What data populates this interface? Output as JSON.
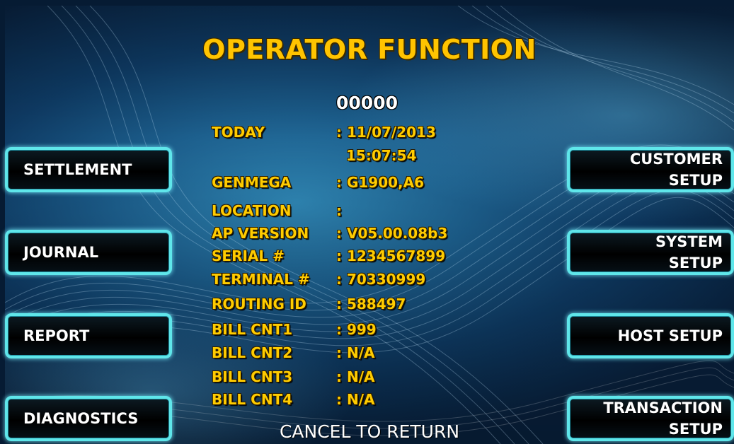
{
  "screen": {
    "title": "OPERATOR FUNCTION",
    "code": "00000",
    "footer": "CANCEL TO RETURN"
  },
  "info": [
    {
      "label": "TODAY",
      "value": ": 11/07/2013"
    },
    {
      "label": "",
      "value": "15:07:54"
    },
    {
      "label": "GENMEGA",
      "value": ": G1900,A6"
    },
    {
      "label": "LOCATION",
      "value": ":"
    },
    {
      "label": "AP VERSION",
      "value": ": V05.00.08b3"
    },
    {
      "label": "SERIAL #",
      "value": ": 1234567899"
    },
    {
      "label": "TERMINAL #",
      "value": ": 70330999"
    },
    {
      "label": "ROUTING ID",
      "value": ": 588497"
    },
    {
      "label": "BILL CNT1",
      "value": ": 999"
    },
    {
      "label": "BILL CNT2",
      "value": ": N/A"
    },
    {
      "label": "BILL CNT3",
      "value": ": N/A"
    },
    {
      "label": "BILL CNT4",
      "value": ": N/A"
    }
  ],
  "left_buttons": [
    "SETTLEMENT",
    "JOURNAL",
    "REPORT",
    "DIAGNOSTICS"
  ],
  "right_buttons": [
    {
      "line1": "CUSTOMER",
      "line2": "SETUP"
    },
    {
      "line1": "SYSTEM",
      "line2": "SETUP"
    },
    {
      "line1": "HOST SETUP",
      "line2": ""
    },
    {
      "line1": "TRANSACTION",
      "line2": "SETUP"
    }
  ],
  "colors": {
    "title": "#ffc400",
    "info_text": "#ffcc00",
    "button_border": "#5fe6ea",
    "button_text": "#ffffff"
  }
}
